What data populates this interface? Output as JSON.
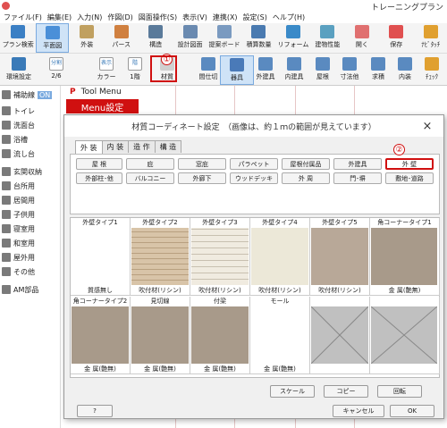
{
  "app": {
    "title": "トレーニングプラン"
  },
  "menu": [
    "ファイル(F)",
    "編集(E)",
    "入力(N)",
    "作図(D)",
    "図面操作(S)",
    "表示(V)",
    "連携(X)",
    "設定(S)",
    "ヘルプ(H)"
  ],
  "toolbar1": [
    "プラン検索",
    "平面図",
    "外装",
    "パース",
    "構造",
    "設計図面",
    "提案ボード",
    "積算数量",
    "リフォーム",
    "建物性能",
    "開く",
    "保存",
    "ﾅﾋﾞﾀｯﾁ",
    "終了"
  ],
  "toolbar2": {
    "env": "環境設定",
    "split": "分割",
    "split_page": "2/6",
    "display": "表示",
    "color": "カラー",
    "floor": "階",
    "floor_val": "1階",
    "material": "材質",
    "items": [
      "間仕切",
      "器具",
      "外建具",
      "内建具",
      "屋根",
      "寸法他",
      "求積",
      "内装",
      "ﾁｪｯｸ"
    ]
  },
  "leftpanel": {
    "items": [
      "補助線",
      "トイレ",
      "洗面台",
      "浴槽",
      "流し台",
      "玄関収納",
      "台所用",
      "居間用",
      "子供用",
      "寝室用",
      "和室用",
      "屋外用",
      "その他",
      "AM部品"
    ],
    "on": "ON"
  },
  "toolmenu": {
    "label": "Tool Menu",
    "settings": "Menu設定"
  },
  "dialog": {
    "title": "材質コーディネート設定　（画像は、約１ｍの範囲が見えています）",
    "tabs": [
      "外 装",
      "内 装",
      "造 作",
      "構 造"
    ],
    "row1": [
      "屋 根",
      "庇",
      "窓庇",
      "パラペット",
      "屋根付属品",
      "外建具",
      "外 壁"
    ],
    "row2": [
      "外部柱･他",
      "バルコニー",
      "外廊下",
      "ウッドデッキ",
      "外 周",
      "門･塀",
      "敷地･道路"
    ],
    "swatches": [
      {
        "label": "外壁タイプ1",
        "sub": "質感無し"
      },
      {
        "label": "外壁タイプ2",
        "sub": "吹付材(リシン)"
      },
      {
        "label": "外壁タイプ3",
        "sub": "吹付材(リシン)"
      },
      {
        "label": "外壁タイプ4",
        "sub": "吹付材(リシン)"
      },
      {
        "label": "外壁タイプ5",
        "sub": "吹付材(リシン)"
      },
      {
        "label": "角コーナータイプ1",
        "sub": "金 属(艶無)"
      },
      {
        "label": "角コーナータイプ2",
        "sub": "金 属(艶無)"
      },
      {
        "label": "見切線",
        "sub": "金 属(艶無)"
      },
      {
        "label": "付梁",
        "sub": "金 属(艶無)"
      },
      {
        "label": "モール",
        "sub": "金 属(艶無)"
      },
      {
        "label": "",
        "sub": ""
      },
      {
        "label": "",
        "sub": ""
      }
    ],
    "buttons": {
      "scale": "スケール",
      "copy": "コピー",
      "rotate": "回転",
      "cancel": "キャンセル",
      "ok": "OK",
      "help": "?"
    },
    "annotations": [
      "①",
      "②"
    ]
  }
}
